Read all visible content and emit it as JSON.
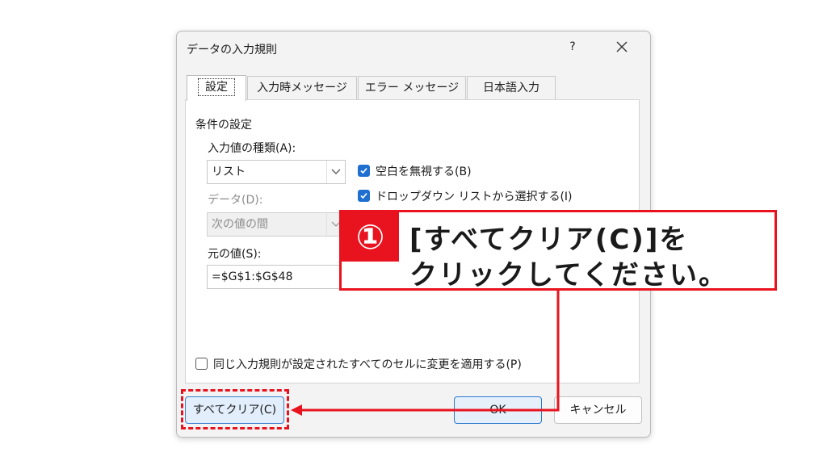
{
  "dialog": {
    "title": "データの入力規則",
    "help_label": "?",
    "tabs": [
      {
        "label": "設定",
        "active": true
      },
      {
        "label": "入力時メッセージ",
        "active": false
      },
      {
        "label": "エラー メッセージ",
        "active": false
      },
      {
        "label": "日本語入力",
        "active": false
      }
    ],
    "settings": {
      "group_label": "条件の設定",
      "allow_label": "入力値の種類(A):",
      "allow_value": "リスト",
      "data_label": "データ(D):",
      "data_value": "次の値の間",
      "source_label": "元の値(S):",
      "source_value": "=$G$1:$G$48",
      "ignore_blank_label": "空白を無視する(B)",
      "ignore_blank_checked": true,
      "dropdown_label": "ドロップダウン リストから選択する(I)",
      "dropdown_checked": true,
      "apply_all_label": "同じ入力規則が設定されたすべてのセルに変更を適用する(P)",
      "apply_all_checked": false
    },
    "buttons": {
      "clear_all": "すべてクリア(C)",
      "ok": "OK",
      "cancel": "キャンセル"
    }
  },
  "callout": {
    "number": "①",
    "line1": "[すべてクリア(C)]を",
    "line2": "クリックしてください。"
  },
  "colors": {
    "accent_red": "#e8131f",
    "checkbox_blue": "#1f6fd1"
  }
}
